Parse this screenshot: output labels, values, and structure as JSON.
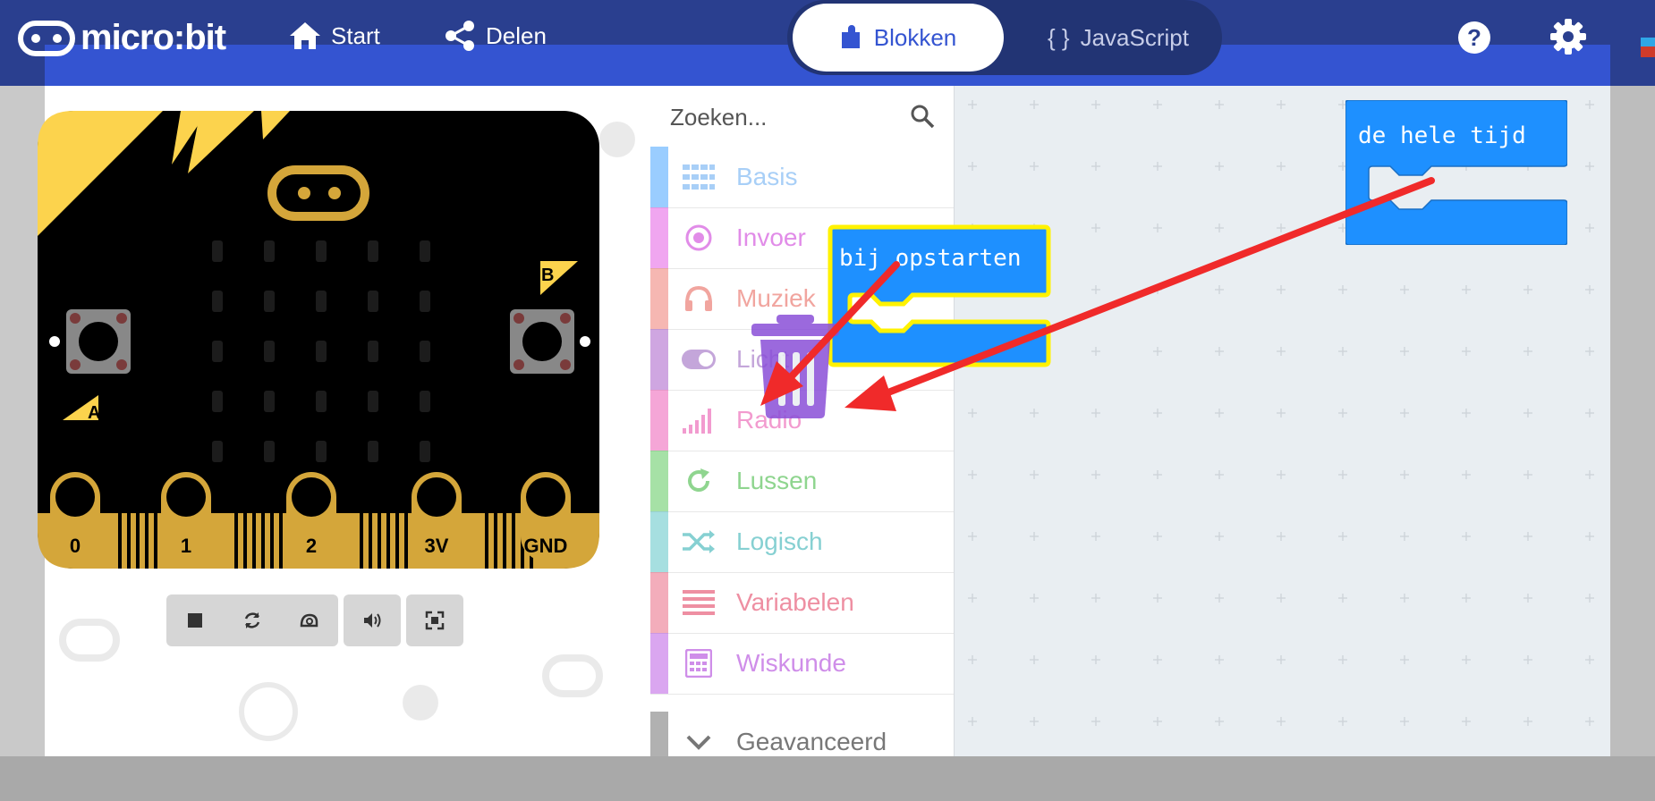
{
  "header": {
    "logo_text": "micro:bit",
    "nav": {
      "start_label": "Start",
      "share_label": "Delen"
    },
    "mode_tabs": {
      "blocks_label": "Blokken",
      "js_label": "JavaScript",
      "js_prefix": "{ }"
    },
    "icons": [
      "microbit-logo-icon",
      "home-icon",
      "share-icon",
      "puzzle-icon",
      "help-icon",
      "gear-icon"
    ]
  },
  "simulator": {
    "pin_labels": [
      "0",
      "1",
      "2",
      "3V",
      "GND"
    ],
    "button_a_label": "A",
    "button_b_label": "B",
    "controls": [
      "stop-icon",
      "restart-icon",
      "slow-motion-icon",
      "sound-icon",
      "fullscreen-icon"
    ]
  },
  "toolbox": {
    "search_placeholder": "Zoeken...",
    "categories": [
      {
        "label": "Basis",
        "color": "#1e90ff",
        "icon": "grid-icon"
      },
      {
        "label": "Invoer",
        "color": "#d400d4",
        "icon": "target-icon"
      },
      {
        "label": "Muziek",
        "color": "#e63022",
        "icon": "headphones-icon"
      },
      {
        "label": "Licht",
        "color": "#7600a8",
        "icon": "toggle-icon"
      },
      {
        "label": "Radio",
        "color": "#e3008c",
        "icon": "signal-bars-icon"
      },
      {
        "label": "Lussen",
        "color": "#00aa00",
        "icon": "loop-arrow-icon"
      },
      {
        "label": "Logisch",
        "color": "#00a4a6",
        "icon": "shuffle-icon"
      },
      {
        "label": "Variabelen",
        "color": "#dc143c",
        "icon": "list-lines-icon"
      },
      {
        "label": "Wiskunde",
        "color": "#9400d3",
        "icon": "calculator-icon"
      },
      {
        "label": "Geavanceerd",
        "color": "#3c3c3c",
        "icon": "chevron-down-icon"
      }
    ]
  },
  "workspace": {
    "block_forever_label": "de hele tijd",
    "block_start_label": "bij opstarten",
    "block_color": "#1e90ff",
    "highlight_color": "#fff200",
    "annotation_color": "#f02a2a"
  }
}
